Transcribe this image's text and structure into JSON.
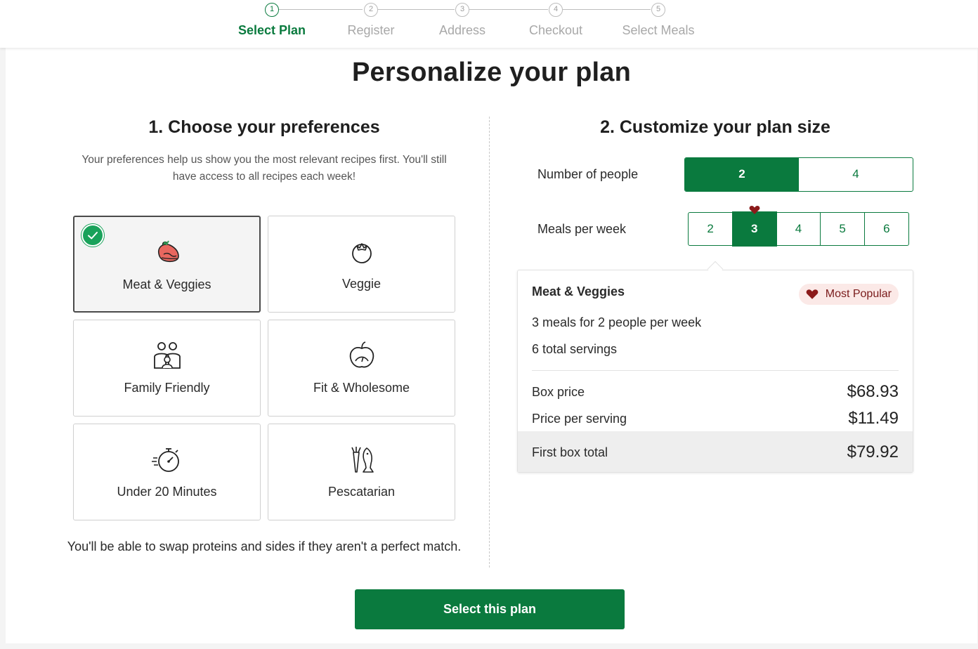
{
  "stepper": {
    "steps": [
      {
        "number": "1",
        "label": "Select Plan",
        "active": true
      },
      {
        "number": "2",
        "label": "Register",
        "active": false
      },
      {
        "number": "3",
        "label": "Address",
        "active": false
      },
      {
        "number": "4",
        "label": "Checkout",
        "active": false
      },
      {
        "number": "5",
        "label": "Select Meals",
        "active": false
      }
    ]
  },
  "page_title": "Personalize your plan",
  "preferences": {
    "title": "1. Choose your preferences",
    "description": "Your preferences help us show you the most relevant recipes first. You'll still have access to all recipes each week!",
    "options": [
      {
        "label": "Meat & Veggies",
        "icon": "steak-icon",
        "selected": true
      },
      {
        "label": "Veggie",
        "icon": "tomato-icon",
        "selected": false
      },
      {
        "label": "Family Friendly",
        "icon": "family-icon",
        "selected": false
      },
      {
        "label": "Fit & Wholesome",
        "icon": "apple-scale-icon",
        "selected": false
      },
      {
        "label": "Under 20 Minutes",
        "icon": "stopwatch-icon",
        "selected": false
      },
      {
        "label": "Pescatarian",
        "icon": "fish-carrot-icon",
        "selected": false
      }
    ],
    "note": "You'll be able to swap proteins and sides if they aren't a perfect match."
  },
  "plan_size": {
    "title": "2. Customize your plan size",
    "people_label": "Number of people",
    "people_options": [
      "2",
      "4"
    ],
    "people_selected": "2",
    "meals_label": "Meals per week",
    "meals_options": [
      "2",
      "3",
      "4",
      "5",
      "6"
    ],
    "meals_selected": "3"
  },
  "summary": {
    "plan_name": "Meat & Veggies",
    "badge": "Most Popular",
    "meals_line": "3 meals for 2 people per week",
    "servings_line": "6 total servings",
    "box_price_label": "Box price",
    "box_price": "$68.93",
    "per_serving_label": "Price per serving",
    "per_serving": "$11.49",
    "total_label": "First box total",
    "total": "$79.92"
  },
  "cta_label": "Select this plan",
  "colors": {
    "brand_green": "#0a7a3e",
    "check_green": "#19a25a",
    "heart_red": "#8b1a1a",
    "badge_bg": "#fbe9e7"
  }
}
